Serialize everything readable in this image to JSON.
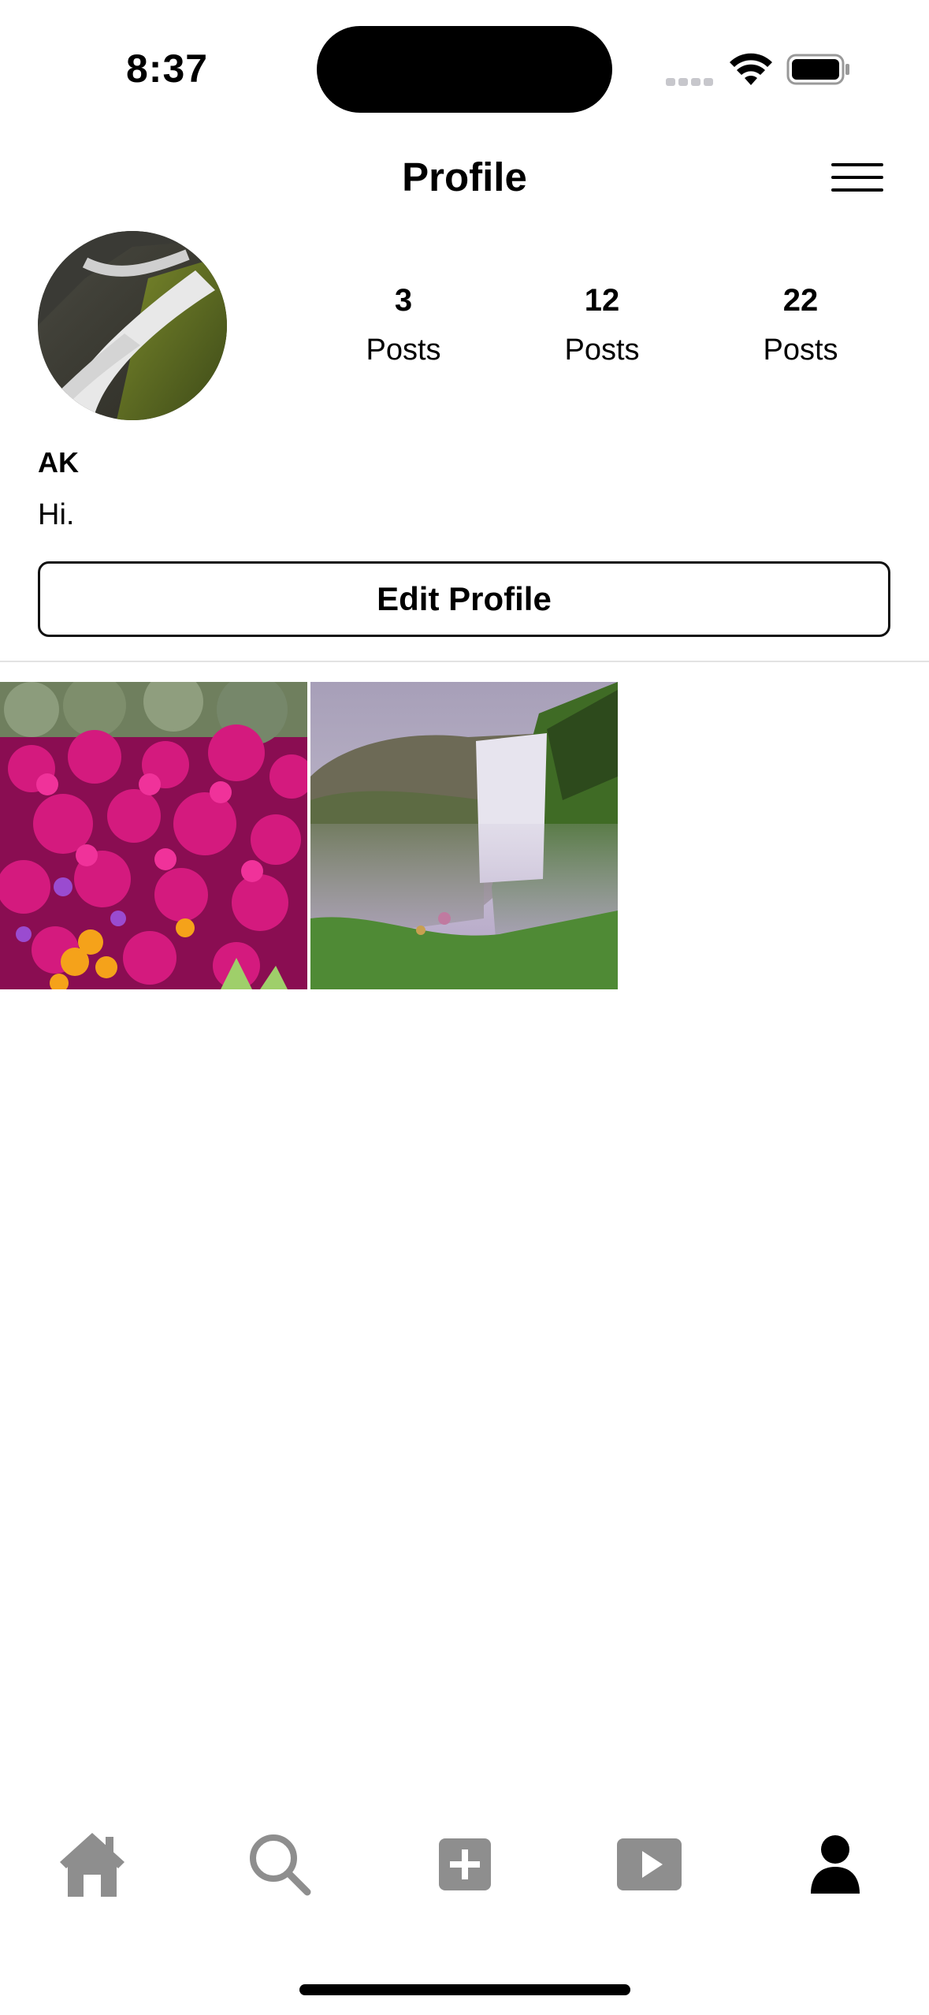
{
  "status_bar": {
    "time": "8:37"
  },
  "header": {
    "title": "Profile"
  },
  "profile": {
    "username": "AK",
    "bio": "Hi.",
    "stats": [
      {
        "count": "3",
        "label": "Posts"
      },
      {
        "count": "12",
        "label": "Posts"
      },
      {
        "count": "22",
        "label": "Posts"
      }
    ],
    "edit_button_label": "Edit Profile"
  },
  "posts": [
    {
      "icon": "flower-field-photo"
    },
    {
      "icon": "waterfall-photo"
    }
  ],
  "tab_bar": {
    "items": [
      {
        "icon": "home-icon",
        "active": false
      },
      {
        "icon": "search-icon",
        "active": false
      },
      {
        "icon": "add-post-icon",
        "active": false
      },
      {
        "icon": "reels-icon",
        "active": false
      },
      {
        "icon": "profile-icon",
        "active": true
      }
    ],
    "inactive_color": "#8e8e8e",
    "active_color": "#000000"
  }
}
